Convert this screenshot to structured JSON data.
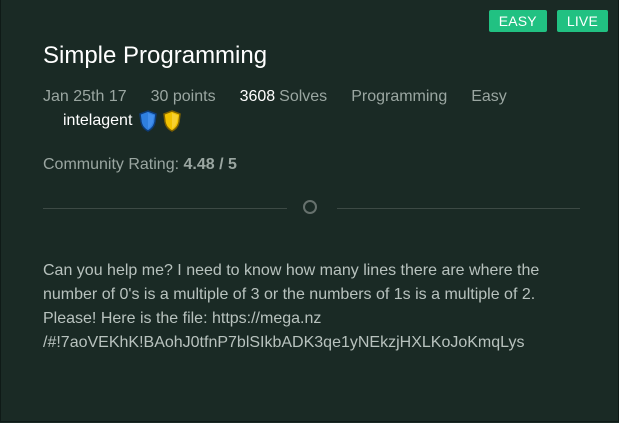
{
  "badges": {
    "difficulty": "EASY",
    "status": "LIVE"
  },
  "challenge": {
    "title": "Simple Programming",
    "date": "Jan 25th 17",
    "points": "30 points",
    "solves_count": "3608",
    "solves_label": "Solves",
    "category": "Programming",
    "difficulty": "Easy",
    "author": "intelagent",
    "rating_label": "Community Rating:",
    "rating_value": "4.48 / 5",
    "description_lines": [
      "Can you help me? I need to know how many lines there are where the",
      "number of 0's is a multiple of 3 or the numbers of 1s is a multiple of 2.",
      "Please! Here is the file: https://mega.nz",
      "/#!7aoVEKhK!BAohJ0tfnP7blSIkbADK3qe1yNEkzjHXLKoJoKmqLys"
    ]
  },
  "colors": {
    "background": "#1a2a25",
    "badge": "#21c182",
    "shield_blue": "#2f7fe0",
    "shield_gold": "#f2c200"
  },
  "icons": {
    "shield_one": "blue-shield-icon",
    "shield_two": "gold-shield-icon",
    "divider_marker": "circle-icon"
  }
}
